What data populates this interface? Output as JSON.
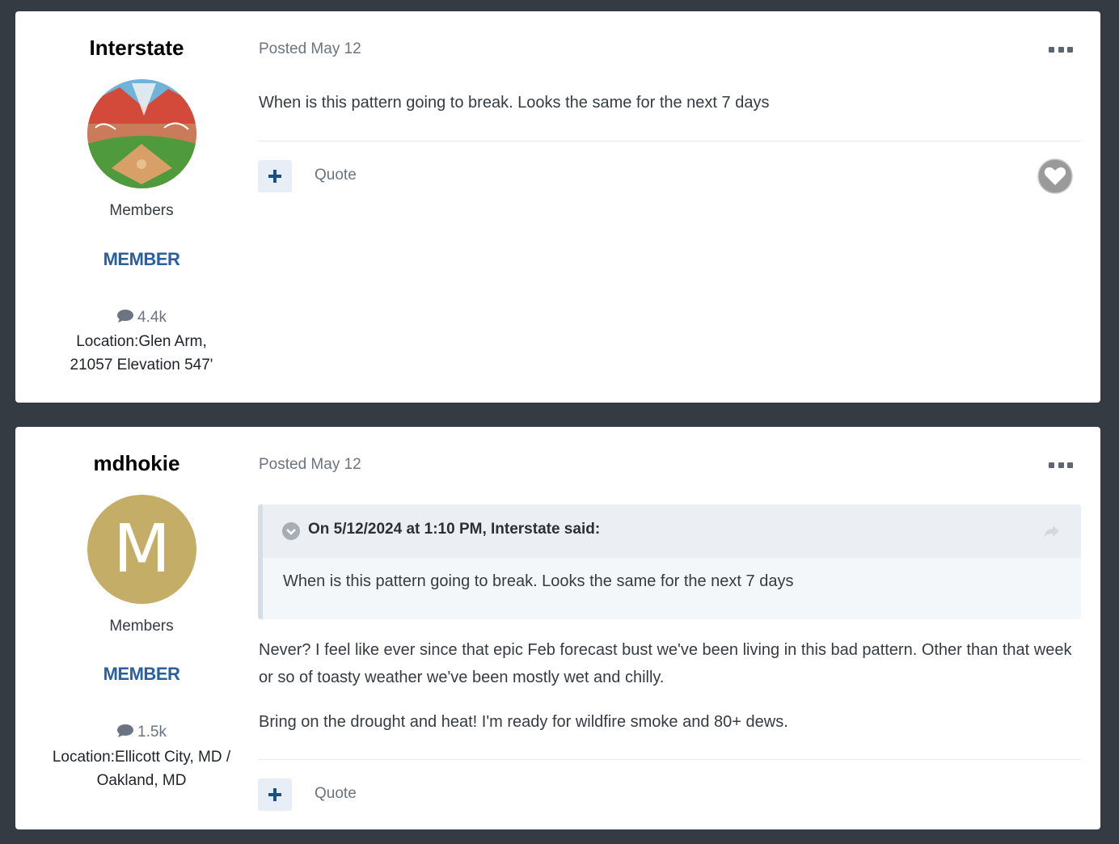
{
  "posts": [
    {
      "author": {
        "name": "Interstate",
        "avatar_type": "photo",
        "group": "Members",
        "rank_badge": "MEMBER",
        "post_count": "4.4k",
        "location": "Location:Glen Arm, 21057 Elevation 547'"
      },
      "posted": "Posted May 12",
      "body": [
        "When is this pattern going to break. Looks the same for the next 7 days"
      ],
      "quote_label": "Quote",
      "icons": [
        "ellipsis-icon",
        "plus-icon",
        "heart-icon",
        "comment-icon"
      ]
    },
    {
      "author": {
        "name": "mdhokie",
        "avatar_type": "letter",
        "avatar_letter": "M",
        "avatar_color": "#c4ad67",
        "group": "Members",
        "rank_badge": "MEMBER",
        "post_count": "1.5k",
        "location": "Location:Ellicott City, MD / Oakland, MD"
      },
      "posted": "Posted May 12",
      "quote": {
        "citation": "On 5/12/2024 at 1:10 PM, Interstate said:",
        "text": "When is this pattern going to break. Looks the same for the next 7 days"
      },
      "body": [
        "Never? I feel like ever since that epic Feb forecast bust we've been living in this bad pattern. Other than that week or so of toasty weather we've been mostly wet and chilly.",
        "Bring on the drought and heat! I'm ready for wildfire smoke and 80+ dews."
      ],
      "quote_label": "Quote",
      "icons": [
        "ellipsis-icon",
        "chevron-down-icon",
        "share-icon",
        "plus-icon",
        "comment-icon"
      ]
    }
  ],
  "colors": {
    "page_background": "#353b43",
    "card_background": "#ffffff",
    "rank_badge": "#2a5fa0",
    "action_button": "#e7eef6",
    "plus_icon": "#1b4f86"
  }
}
